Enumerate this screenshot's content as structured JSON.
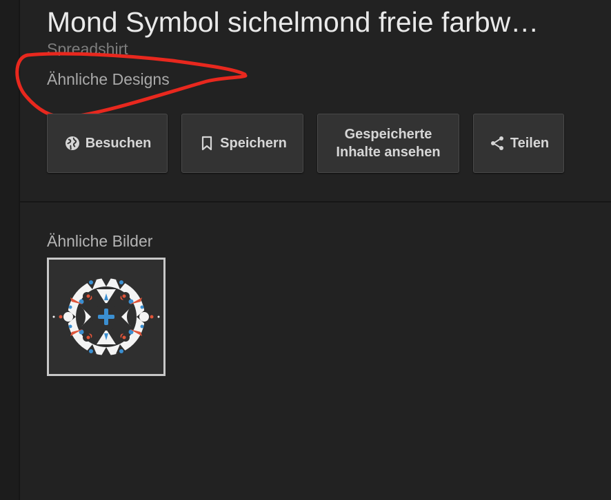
{
  "header": {
    "title": "Mond Symbol sichelmond freie farbw…",
    "source": "Spreadshirt",
    "similar_designs": "Ähnliche Designs"
  },
  "actions": {
    "visit_label": "Besuchen",
    "save_label": "Speichern",
    "saved_line1": "Gespeicherte",
    "saved_line2": "Inhalte ansehen",
    "share_label": "Teilen"
  },
  "similar_images": {
    "heading": "Ähnliche Bilder"
  },
  "colors": {
    "background": "#222222",
    "annotation": "#e8281e",
    "accent_blue": "#3b8fd1",
    "accent_red": "#e0553a"
  },
  "icons": [
    "globe-icon",
    "bookmark-icon",
    "share-icon"
  ]
}
